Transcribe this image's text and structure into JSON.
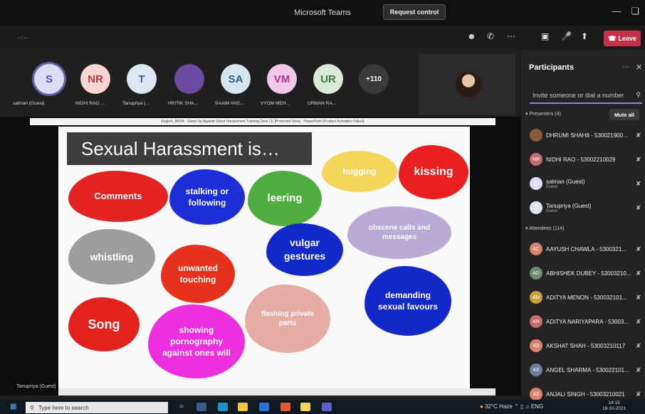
{
  "window": {
    "title": "Microsoft Teams"
  },
  "toolbar": {
    "timer": "--:--",
    "request_control": "Request control",
    "leave": "Leave"
  },
  "strip": {
    "participants": [
      {
        "initials": "S",
        "name": "salman (Guest)",
        "bg": "#dcdcf5",
        "fg": "#4b53bc"
      },
      {
        "initials": "NR",
        "name": "NIDHI RAO ...",
        "bg": "#f7d7d0",
        "fg": "#c4314b"
      },
      {
        "initials": "T",
        "name": "Tanupriya (...",
        "bg": "#dde7f3",
        "fg": "#3f5b8a"
      },
      {
        "initials": "",
        "name": "HRITIK SHA...",
        "bg": "#6b4aa0",
        "fg": "#fff"
      },
      {
        "initials": "SA",
        "name": "SAAIM ANS...",
        "bg": "#d6e6f0",
        "fg": "#335f7d"
      },
      {
        "initials": "VM",
        "name": "VYOM MEH...",
        "bg": "#f2c8ea",
        "fg": "#a03b8f"
      },
      {
        "initials": "UR",
        "name": "URMAN RA...",
        "bg": "#d8ead8",
        "fg": "#3f7a3f"
      }
    ],
    "overflow": "+110"
  },
  "shared": {
    "ppt_title": "English_INDIA - Stand Up Against Street Harassment Training Deck (1) [Protected View] - PowerPoint (Product Activation Failed)",
    "slide_title": "Sexual Harassment is…",
    "clouds": [
      {
        "text": "Comments",
        "color": "#e32222",
        "text_color": "#ffffff"
      },
      {
        "text": "stalking or following",
        "color": "#1c2fd6",
        "text_color": "#ffffff"
      },
      {
        "text": "leering",
        "color": "#4fae3f",
        "text_color": "#ffffff"
      },
      {
        "text": "hugging",
        "color": "#f4d75a",
        "text_color": "#ffffff"
      },
      {
        "text": "kissing",
        "color": "#ea1f1f",
        "text_color": "#ffffff"
      },
      {
        "text": "whistling",
        "color": "#9d9d9d",
        "text_color": "#ffffff"
      },
      {
        "text": "unwanted touching",
        "color": "#e4321d",
        "text_color": "#ffffff"
      },
      {
        "text": "vulgar gestures",
        "color": "#1328c8",
        "text_color": "#ffffff"
      },
      {
        "text": "obscene calls and messages",
        "color": "#b9aad6",
        "text_color": "#ffffff"
      },
      {
        "text": "demanding sexual favours",
        "color": "#1328c8",
        "text_color": "#ffffff"
      },
      {
        "text": "Song",
        "color": "#e4221d",
        "text_color": "#ffffff"
      },
      {
        "text": "showing pornography against ones will",
        "color": "#ee2fe0",
        "text_color": "#ffffff"
      },
      {
        "text": "flashing private parts",
        "color": "#e6aca3",
        "text_color": "#ffffff"
      }
    ],
    "presenter_label": "Tanupriya (Guest)"
  },
  "panel": {
    "title": "Participants",
    "invite_placeholder": "Invite someone or dial a number",
    "presenters_label": "Presenters (4)",
    "mute_all": "Mute all",
    "attendees_label": "Attendees (114)",
    "presenters": [
      {
        "initials": "",
        "name": "DHRUMI SHAH8 - 530021900...",
        "sub": "",
        "bg": "#8a5a3c"
      },
      {
        "initials": "NR",
        "name": "NIDHI RAO - 53002210029",
        "sub": "",
        "bg": "#c46b6b"
      },
      {
        "initials": "S",
        "name": "salman (Guest)",
        "sub": "Guest",
        "bg": "#dcdcf5"
      },
      {
        "initials": "T",
        "name": "Tanupriya (Guest)",
        "sub": "Guest",
        "bg": "#dde7f3"
      }
    ],
    "attendees": [
      {
        "initials": "AC",
        "name": "AAYUSH CHAWLA - 5300321...",
        "bg": "#d9826a"
      },
      {
        "initials": "AD",
        "name": "ABHISHEK DUBEY - 53003210...",
        "bg": "#6a8a6a"
      },
      {
        "initials": "AM",
        "name": "ADITYA MENON - 530032101...",
        "bg": "#c7a23a"
      },
      {
        "initials": "AN",
        "name": "ADITYA NARIYAPARA - 53003...",
        "bg": "#c46b6b"
      },
      {
        "initials": "AS",
        "name": "AKSHAT SHAH - 53003210117",
        "bg": "#d9826a"
      },
      {
        "initials": "AS",
        "name": "ANGEL SHARMA - 530022101...",
        "bg": "#6a7ea0"
      },
      {
        "initials": "AS",
        "name": "ANJALI SINGH - 53003210021",
        "bg": "#d9826a"
      }
    ]
  },
  "taskbar": {
    "search_placeholder": "Type here to search",
    "weather": "32°C  Haze",
    "lang": "ENG",
    "time": "14:15",
    "date": "18-10-2021"
  }
}
